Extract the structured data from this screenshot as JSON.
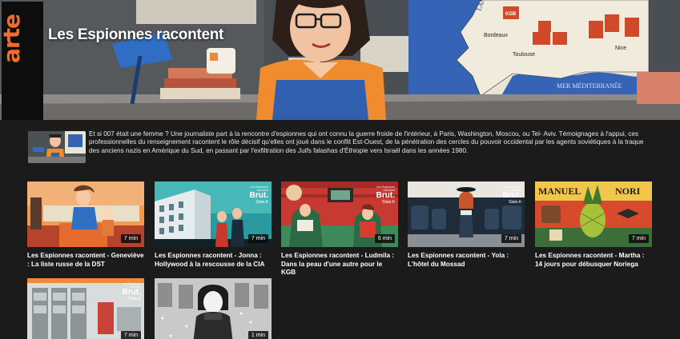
{
  "header": {
    "logo": "arte",
    "title": "Les Espionnes racontent"
  },
  "description": "Et si 007 était une femme ?  Une journaliste part à la rencontre d'espionnes qui ont connu la guerre froide de l'intérieur, à Paris, Washington, Moscou, ou Tel- Aviv. Témoignages à l'appui, ces professionnelles du renseignement racontent le rôle décisif qu'elles ont joué dans le conflit Est-Ouest, de la pénétration des cercles du pouvoir occidental par les agents soviétiques à la traque des anciens nazis en Amérique du Sud, en passant par l'exfiltration des Juifs falashas d'Éthiopie vers Israël dans les années 1980.",
  "hero_map_labels": {
    "sea": "LANTIQUE",
    "mer": "MER\nMÉDITERRANÉE",
    "cities": [
      "Bordeaux",
      "Toulouse",
      "Nice"
    ],
    "kgb": "KGB"
  },
  "brut": {
    "small": "Les Espionnes racontent",
    "brand": "Brut.",
    "slate": "Slate.fr"
  },
  "episodes": [
    {
      "title": "Les Espionnes racontent - Geneviève : La liste russe de la DST",
      "duration": "7 min",
      "badge": true
    },
    {
      "title": "Les Espionnes racontent - Jonna : Hollywood à la rescousse de la CIA",
      "duration": "7 min",
      "badge": true
    },
    {
      "title": "Les Espionnes racontent - Ludmila : Dans la peau d'une autre pour le KGB",
      "duration": "6 min",
      "badge": true
    },
    {
      "title": "Les Espionnes racontent - Yola : L'hôtel du Mossad",
      "duration": "7 min",
      "badge": true
    },
    {
      "title": "Les Espionnes racontent - Martha : 14 jours pour débusquer Noriega",
      "duration": "7 min",
      "badge": false,
      "banner_left": "MANUEL",
      "banner_right": "NORI"
    },
    {
      "title": "",
      "duration": "7 min",
      "badge": true
    },
    {
      "title": "",
      "duration": "1 min",
      "badge": false
    }
  ],
  "colors": {
    "background": "#1b1b1b",
    "arte_orange": "#f56b2a",
    "map_blue": "#2f5aa8",
    "kgb_red": "#d04a2a"
  }
}
